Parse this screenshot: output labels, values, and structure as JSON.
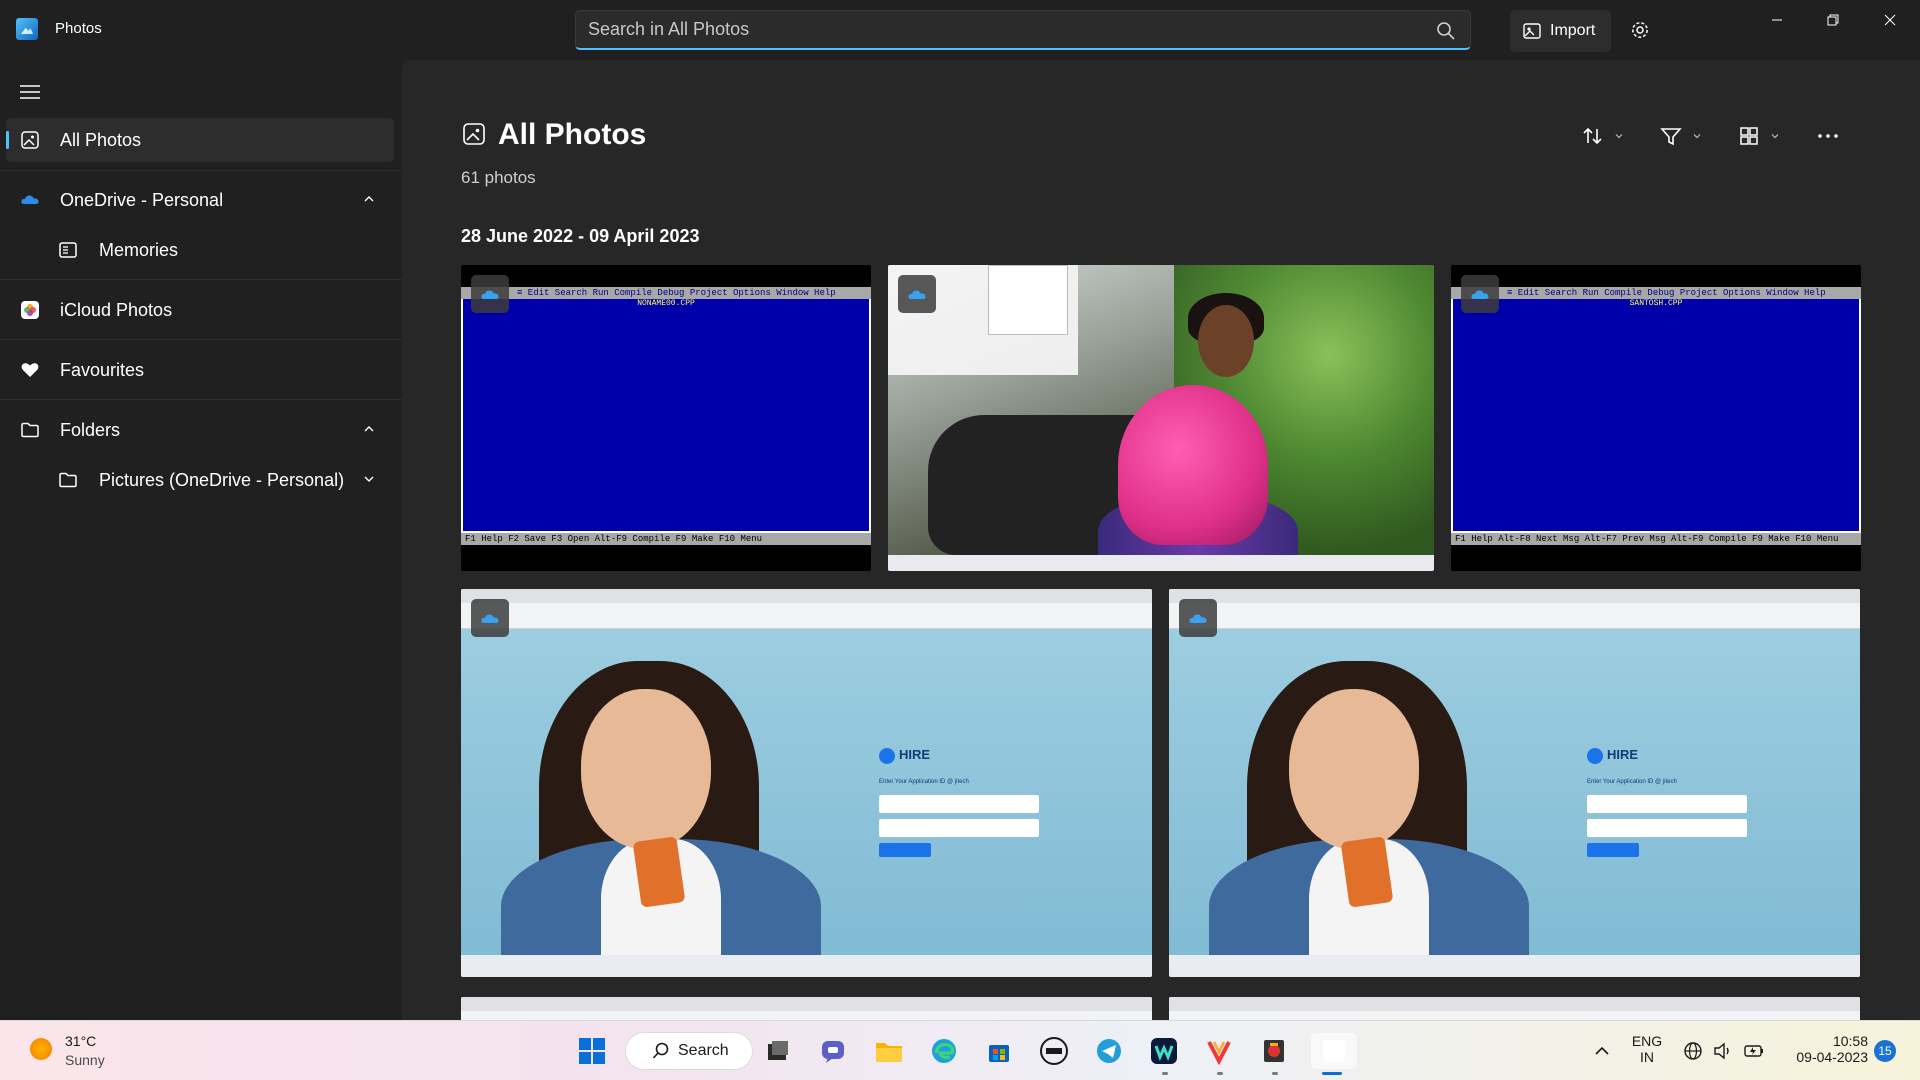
{
  "window": {
    "app_title": "Photos",
    "search_placeholder": "Search in All Photos",
    "import_label": "Import"
  },
  "sidebar": {
    "items": [
      {
        "label": "All Photos",
        "icon": "photo-icon",
        "active": true
      },
      {
        "label": "OneDrive - Personal",
        "icon": "onedrive-icon",
        "expanded": true
      },
      {
        "label": "Memories",
        "icon": "memories-icon"
      },
      {
        "label": "iCloud Photos",
        "icon": "icloud-icon"
      },
      {
        "label": "Favourites",
        "icon": "heart-icon"
      },
      {
        "label": "Folders",
        "icon": "folder-icon",
        "expanded": true
      },
      {
        "label": "Pictures (OneDrive - Personal)",
        "icon": "folder-icon",
        "expanded": false
      }
    ]
  },
  "main": {
    "title": "All Photos",
    "count": "61 photos",
    "date_range": "28 June 2022 - 09 April 2023",
    "photos": [
      {
        "type": "turbo-c-screenshot",
        "menu": "≡  Edit  Search  Run  Compile  Debug  Project  Options     Window  Help",
        "filename": "NONAME00.CPP",
        "status": "F1 Help  F2 Save  F3 Open  Alt-F9 Compile  F9 Make  F10 Menu"
      },
      {
        "type": "outdoor-photo"
      },
      {
        "type": "turbo-c-screenshot",
        "menu": "≡  Edit  Search  Run  Compile  Debug  Project  Options     Window  Help",
        "filename": "SANTOSH.CPP",
        "status": "F1 Help  Alt-F8 Next Msg  Alt-F7 Prev Msg  Alt-F9 Compile  F9 Make  F10 Menu"
      },
      {
        "type": "web-login-screenshot",
        "brand": "HIRE",
        "enter_text": "Enter Your Application ID @ jitech"
      },
      {
        "type": "web-login-screenshot",
        "brand": "HIRE",
        "enter_text": "Enter Your Application ID @ jitech"
      }
    ]
  },
  "taskbar": {
    "weather_temp": "31°C",
    "weather_desc": "Sunny",
    "search_label": "Search",
    "lang_line1": "ENG",
    "lang_line2": "IN",
    "time": "10:58",
    "date": "09-04-2023",
    "notifications": "15"
  },
  "colors": {
    "accent": "#4cc2ff",
    "background": "#202020",
    "content_bg": "#272727"
  }
}
